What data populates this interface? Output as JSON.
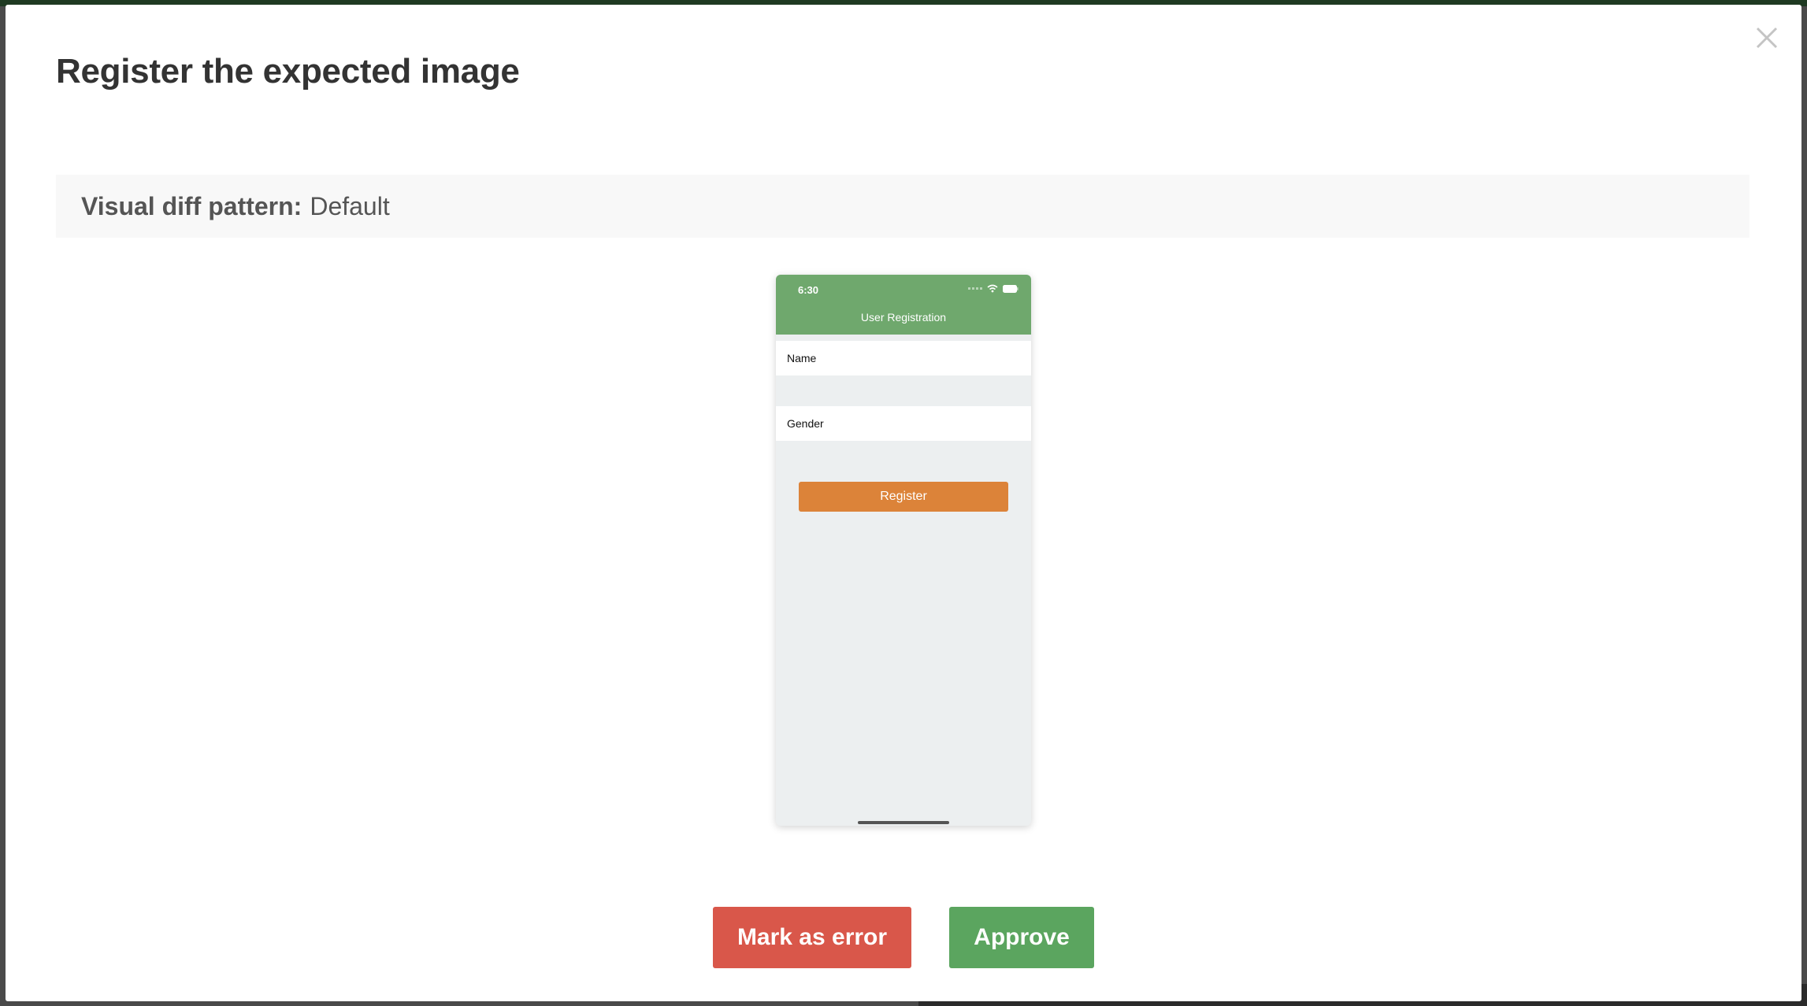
{
  "modal": {
    "title": "Register the expected image",
    "pattern_label": "Visual diff pattern:",
    "pattern_value": "Default"
  },
  "preview": {
    "status_time": "6:30",
    "header_title": "User Registration",
    "fields": [
      "Name",
      "Gender"
    ],
    "register_label": "Register"
  },
  "actions": {
    "error_label": "Mark as error",
    "approve_label": "Approve"
  },
  "colors": {
    "error": "#d9574a",
    "approve": "#5ba55f",
    "phone_header": "#6fa86d",
    "register_button": "#dc8339"
  },
  "icons": {
    "close": "close-icon",
    "wifi": "wifi-icon",
    "battery": "battery-icon"
  }
}
